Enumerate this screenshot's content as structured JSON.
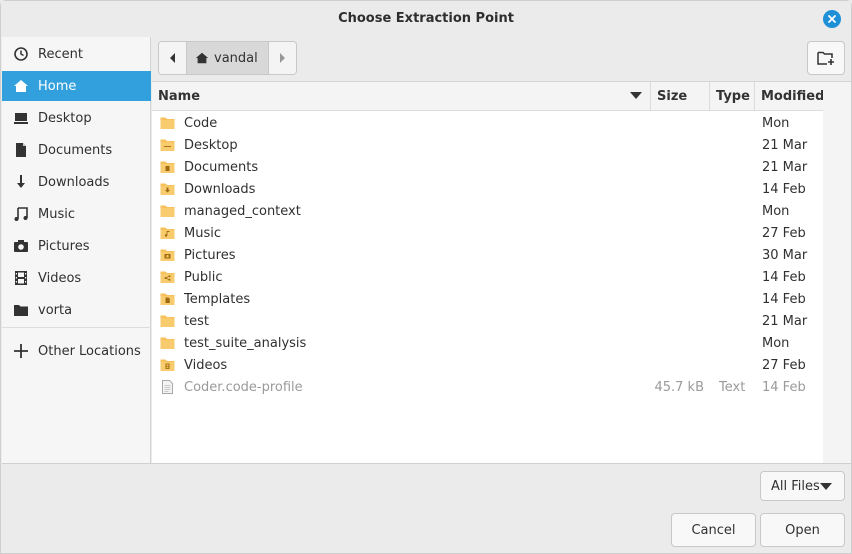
{
  "window": {
    "title": "Choose Extraction Point"
  },
  "sidebar": {
    "items": [
      {
        "label": "Recent",
        "icon": "clock-icon"
      },
      {
        "label": "Home",
        "icon": "home-icon",
        "active": true
      },
      {
        "label": "Desktop",
        "icon": "desktop-icon"
      },
      {
        "label": "Documents",
        "icon": "document-icon"
      },
      {
        "label": "Downloads",
        "icon": "download-icon"
      },
      {
        "label": "Music",
        "icon": "music-icon"
      },
      {
        "label": "Pictures",
        "icon": "camera-icon"
      },
      {
        "label": "Videos",
        "icon": "film-icon"
      },
      {
        "label": "vorta",
        "icon": "folder-icon"
      }
    ],
    "other_locations": {
      "label": "Other Locations",
      "icon": "plus-icon"
    }
  },
  "pathbar": {
    "crumb": "vandal"
  },
  "columns": {
    "name": "Name",
    "size": "Size",
    "type": "Type",
    "modified": "Modified"
  },
  "files": [
    {
      "name": "Code",
      "size": "",
      "type": "",
      "modified": "Mon",
      "icon": "folder-icon"
    },
    {
      "name": "Desktop",
      "size": "",
      "type": "",
      "modified": "21 Mar",
      "icon": "folder-desktop-icon"
    },
    {
      "name": "Documents",
      "size": "",
      "type": "",
      "modified": "21 Mar",
      "icon": "folder-documents-icon"
    },
    {
      "name": "Downloads",
      "size": "",
      "type": "",
      "modified": "14 Feb",
      "icon": "folder-download-icon"
    },
    {
      "name": "managed_context",
      "size": "",
      "type": "",
      "modified": "Mon",
      "icon": "folder-icon"
    },
    {
      "name": "Music",
      "size": "",
      "type": "",
      "modified": "27 Feb",
      "icon": "folder-music-icon"
    },
    {
      "name": "Pictures",
      "size": "",
      "type": "",
      "modified": "30 Mar",
      "icon": "folder-pictures-icon"
    },
    {
      "name": "Public",
      "size": "",
      "type": "",
      "modified": "14 Feb",
      "icon": "folder-public-icon"
    },
    {
      "name": "Templates",
      "size": "",
      "type": "",
      "modified": "14 Feb",
      "icon": "folder-templates-icon"
    },
    {
      "name": "test",
      "size": "",
      "type": "",
      "modified": "21 Mar",
      "icon": "folder-icon"
    },
    {
      "name": "test_suite_analysis",
      "size": "",
      "type": "",
      "modified": "Mon",
      "icon": "folder-icon"
    },
    {
      "name": "Videos",
      "size": "",
      "type": "",
      "modified": "27 Feb",
      "icon": "folder-videos-icon"
    },
    {
      "name": "Coder.code-profile",
      "size": "45.7 kB",
      "type": "Text",
      "modified": "14 Feb",
      "icon": "text-file-icon",
      "dimmed": true
    }
  ],
  "filter": {
    "label": "All Files"
  },
  "buttons": {
    "cancel": "Cancel",
    "open": "Open"
  },
  "colors": {
    "accent": "#32a0dc",
    "folder": "#f6c15a",
    "close": "#1e90d8"
  }
}
